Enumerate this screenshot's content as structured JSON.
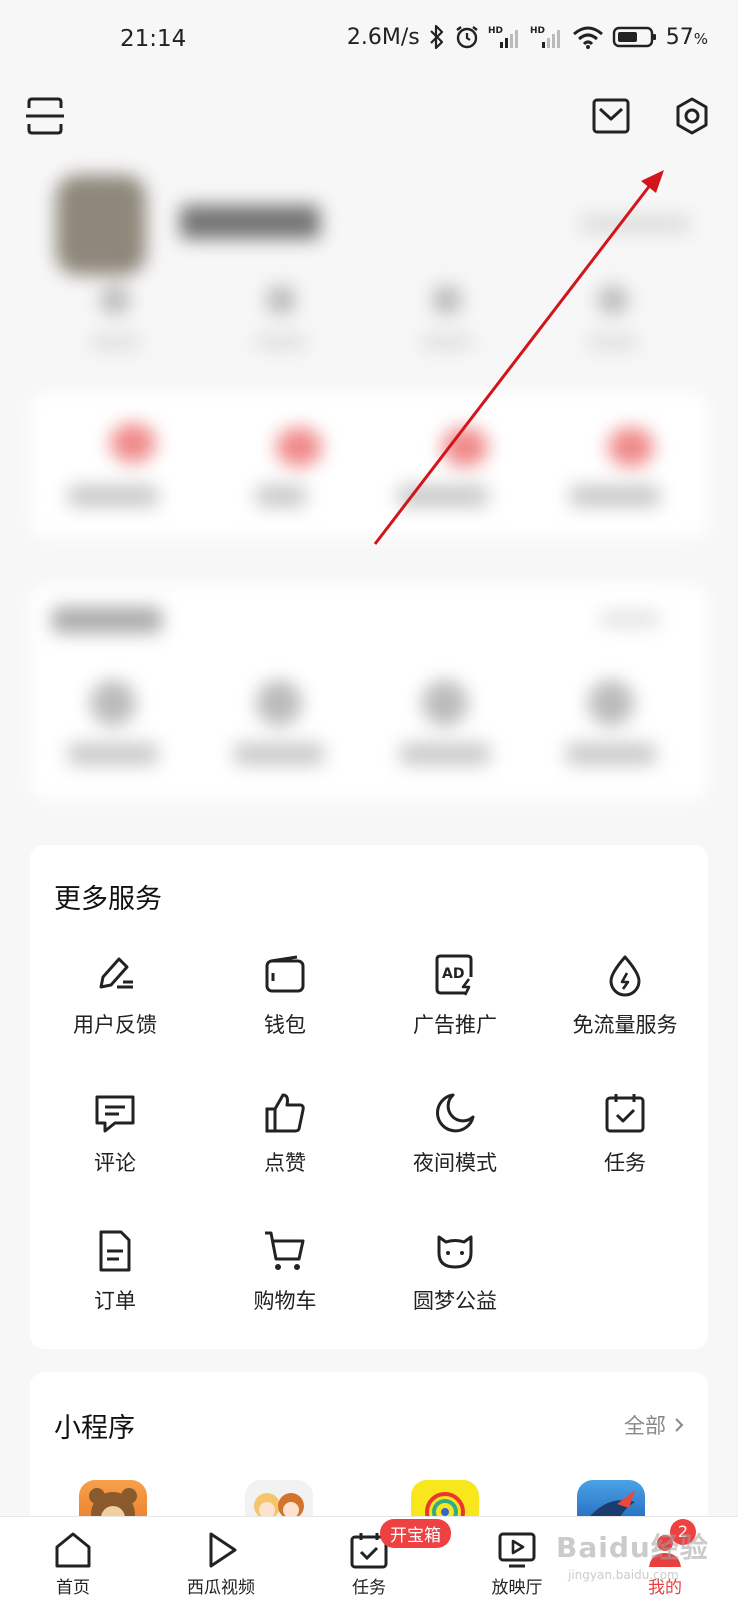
{
  "status_bar": {
    "time": "21:14",
    "net_speed": "2.6M/s",
    "battery_pct": "57",
    "battery_unit": "%",
    "icons": [
      "bluetooth-icon",
      "alarm-icon",
      "hd-signal-icon",
      "hd-signal-icon",
      "wifi-icon",
      "battery-icon"
    ]
  },
  "top_bar": {
    "icons": [
      "scan-icon",
      "mail-icon",
      "settings-gear-icon"
    ]
  },
  "more_services": {
    "title": "更多服务",
    "items": [
      {
        "label": "用户反馈",
        "icon": "feedback-pen-icon"
      },
      {
        "label": "钱包",
        "icon": "wallet-icon"
      },
      {
        "label": "广告推广",
        "icon": "ad-icon"
      },
      {
        "label": "免流量服务",
        "icon": "data-drop-icon"
      },
      {
        "label": "评论",
        "icon": "comment-icon"
      },
      {
        "label": "点赞",
        "icon": "thumbs-up-icon"
      },
      {
        "label": "夜间模式",
        "icon": "moon-icon"
      },
      {
        "label": "任务",
        "icon": "task-calendar-icon"
      },
      {
        "label": "订单",
        "icon": "order-doc-icon"
      },
      {
        "label": "购物车",
        "icon": "cart-icon"
      },
      {
        "label": "圆梦公益",
        "icon": "charity-cat-icon"
      }
    ]
  },
  "mini_programs": {
    "title": "小程序",
    "all_label": "全部"
  },
  "bottom_nav": {
    "items": [
      {
        "label": "首页",
        "icon": "home-icon"
      },
      {
        "label": "西瓜视频",
        "icon": "play-icon"
      },
      {
        "label": "任务",
        "icon": "task-icon",
        "badge": "开宝箱"
      },
      {
        "label": "放映厅",
        "icon": "tv-icon"
      },
      {
        "label": "我的",
        "icon": "profile-icon",
        "count": "2"
      }
    ]
  },
  "watermark": {
    "brand": "Baidu经验",
    "url": "jingyan.baidu.com"
  },
  "colors": {
    "accent_red": "#f04142",
    "annotation_arrow": "#d0161b"
  }
}
